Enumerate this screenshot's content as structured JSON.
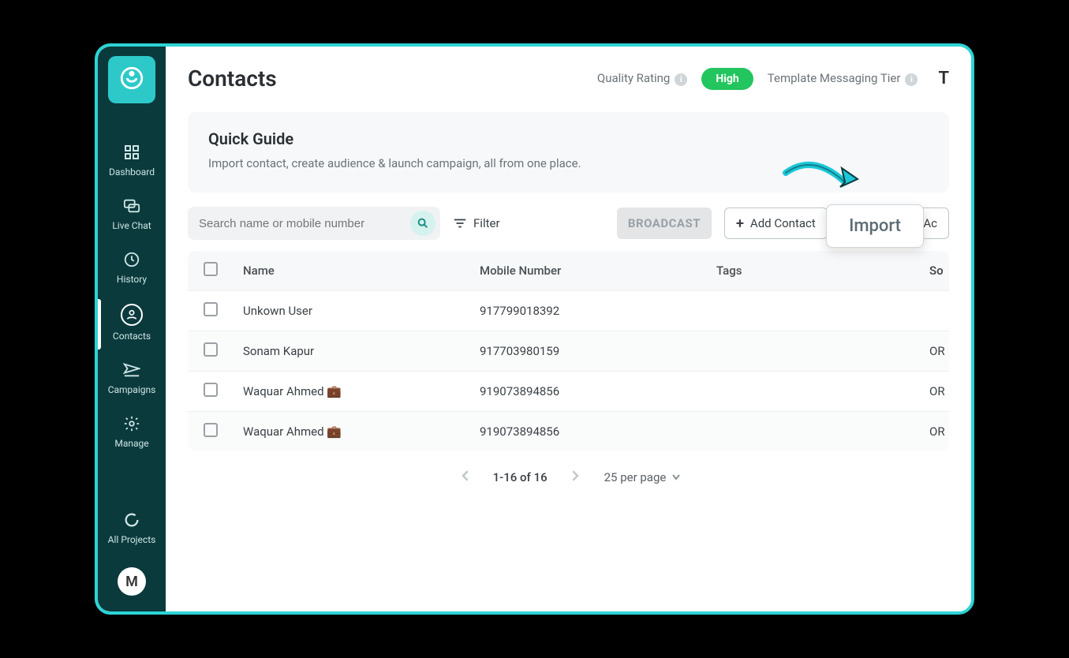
{
  "page": {
    "title": "Contacts"
  },
  "header": {
    "quality_label": "Quality Rating",
    "quality_value": "High",
    "tier_label": "Template Messaging Tier",
    "trailing": "T"
  },
  "sidebar": {
    "items": [
      {
        "key": "dashboard",
        "label": "Dashboard"
      },
      {
        "key": "live-chat",
        "label": "Live Chat"
      },
      {
        "key": "history",
        "label": "History"
      },
      {
        "key": "contacts",
        "label": "Contacts"
      },
      {
        "key": "campaigns",
        "label": "Campaigns"
      },
      {
        "key": "manage",
        "label": "Manage"
      },
      {
        "key": "all-projects",
        "label": "All Projects"
      }
    ],
    "avatar_letter": "M"
  },
  "quick_guide": {
    "title": "Quick Guide",
    "subtitle": "Import contact, create audience & launch campaign, all from one place."
  },
  "toolbar": {
    "search_placeholder": "Search name or mobile number",
    "filter_label": "Filter",
    "broadcast_label": "BROADCAST",
    "add_contact_label": "Add Contact",
    "import_label": "Import",
    "actions_partial": "Ac"
  },
  "callout": {
    "import_label": "Import"
  },
  "table": {
    "columns": {
      "name": "Name",
      "mobile": "Mobile Number",
      "tags": "Tags",
      "source": "So"
    },
    "rows": [
      {
        "name": "Unkown User",
        "mobile": "917799018392",
        "tags": "",
        "source": ""
      },
      {
        "name": "Sonam Kapur",
        "mobile": "917703980159",
        "tags": "",
        "source": "OR"
      },
      {
        "name": "Waquar Ahmed 💼",
        "mobile": "919073894856",
        "tags": "",
        "source": "OR"
      },
      {
        "name": "Waquar Ahmed 💼",
        "mobile": "919073894856",
        "tags": "",
        "source": "OR"
      }
    ]
  },
  "pagination": {
    "range": "1-16 of 16",
    "per_page_label": "25 per page"
  }
}
